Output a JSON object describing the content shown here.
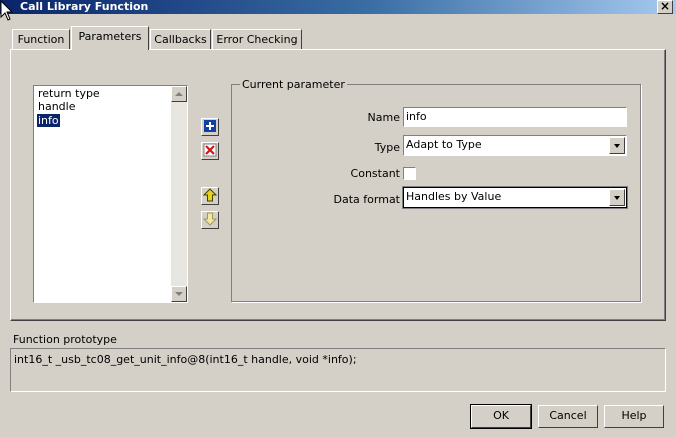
{
  "window": {
    "title": "Call Library Function",
    "close_glyph": "×"
  },
  "tabs": [
    {
      "label": "Function"
    },
    {
      "label": "Parameters"
    },
    {
      "label": "Callbacks"
    },
    {
      "label": "Error Checking"
    }
  ],
  "active_tab": "Parameters",
  "parameters": {
    "items": [
      "return type",
      "handle",
      "info"
    ],
    "selected": "info"
  },
  "toolbar_icons": {
    "add": "plus-icon",
    "delete": "delete-x-icon",
    "move_up": "arrow-up-icon",
    "move_down": "arrow-down-icon"
  },
  "current_parameter": {
    "group_title": "Current parameter",
    "name_label": "Name",
    "name_value": "info",
    "type_label": "Type",
    "type_value": "Adapt to Type",
    "constant_label": "Constant",
    "constant_checked": false,
    "data_format_label": "Data format",
    "data_format_value": "Handles by Value"
  },
  "prototype": {
    "label": "Function prototype",
    "text": "int16_t _usb_tc08_get_unit_info@8(int16_t handle, void *info);"
  },
  "buttons": {
    "ok": "OK",
    "cancel": "Cancel",
    "help": "Help"
  },
  "colors": {
    "titlebar": "#0a246a",
    "face": "#d4d0c8",
    "selection": "#0a246a",
    "add_icon": "#1040a0",
    "delete_icon": "#d01818",
    "arrow_icon": "#e8d020"
  }
}
